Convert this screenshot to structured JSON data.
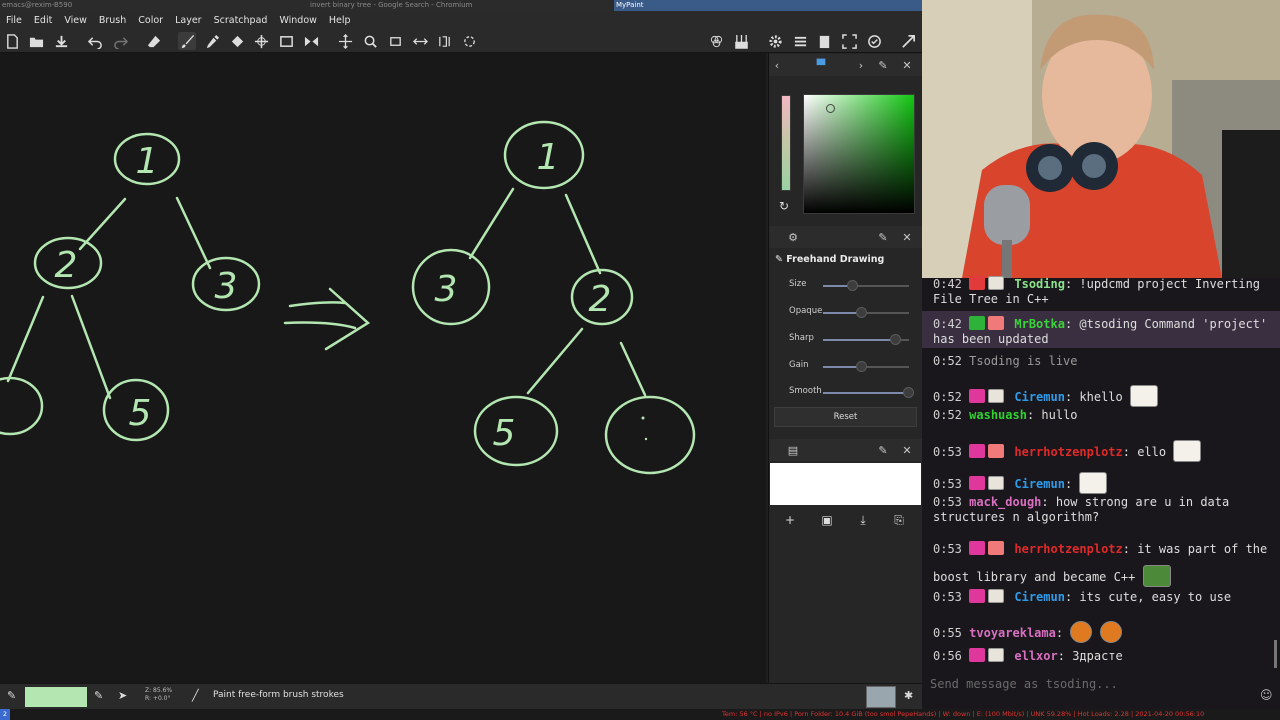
{
  "window_titles": {
    "left": "emacs@rexim-B590",
    "middle": "invert binary tree - Google Search - Chromium",
    "active": "MyPaint"
  },
  "menu": [
    "File",
    "Edit",
    "View",
    "Brush",
    "Color",
    "Layer",
    "Scratchpad",
    "Window",
    "Help"
  ],
  "brush_panel": {
    "title": "Freehand Drawing",
    "sliders": [
      {
        "label": "Size",
        "value": 0.35
      },
      {
        "label": "Opaque",
        "value": 0.45
      },
      {
        "label": "Sharp",
        "value": 0.85
      },
      {
        "label": "Gain",
        "value": 0.45
      },
      {
        "label": "Smooth",
        "value": 1.0
      }
    ],
    "reset_label": "Reset"
  },
  "status": {
    "zoom": "Z: 85.6%",
    "rotation": "R: +0.0°",
    "message": "Paint free-form brush strokes",
    "color": "#b3e6b0"
  },
  "canvas_labels": {
    "left_tree": [
      "1",
      "2",
      "3",
      "5"
    ],
    "right_tree": [
      "1",
      "3",
      "2",
      "5"
    ]
  },
  "bottom_bar": {
    "workspace": "2",
    "text": "Tem: 56 °C | no IPv6 | Porn Folder: 10.4 GiB (too smol PepeHands) | W: down | E: (100 Mbit/s) | UNK 59.28% | Hot Loads: 2.28 | 2021-04-20 00:56:10"
  },
  "chat": {
    "messages": [
      {
        "time": "0:42",
        "user": "Tsoding",
        "user_color": "#8be38b",
        "text": "!updcmd project Inverting File Tree in C++"
      },
      {
        "time": "0:42",
        "user": "MrBotka",
        "user_color": "#3ad43a",
        "text": "@tsoding Command 'project' has been updated"
      },
      {
        "time": "0:52",
        "user": "",
        "user_color": "#9a9a9a",
        "text": "Tsoding is live"
      },
      {
        "time": "0:52",
        "user": "Ciremun",
        "user_color": "#2e9be8",
        "text": "khello"
      },
      {
        "time": "0:52",
        "user": "washuash",
        "user_color": "#2fd12f",
        "text": "hullo"
      },
      {
        "time": "0:53",
        "user": "herrhotzenplotz",
        "user_color": "#e02a2a",
        "text": "ello"
      },
      {
        "time": "0:53",
        "user": "Ciremun",
        "user_color": "#2e9be8",
        "text": ""
      },
      {
        "time": "0:53",
        "user": "mack_dough",
        "user_color": "#d86fc0",
        "text": "how strong are u in data structures n algorithm?"
      },
      {
        "time": "0:53",
        "user": "herrhotzenplotz",
        "user_color": "#e02a2a",
        "text": "it was part of the boost library and became C++"
      },
      {
        "time": "0:53",
        "user": "Ciremun",
        "user_color": "#2e9be8",
        "text": "its cute, easy to use"
      },
      {
        "time": "0:55",
        "user": "tvoyareklama",
        "user_color": "#d86fc0",
        "text": ""
      },
      {
        "time": "0:56",
        "user": "ellxor",
        "user_color": "#d86fc0",
        "text": "Здрасте"
      }
    ],
    "input_placeholder": "Send message as tsoding..."
  }
}
